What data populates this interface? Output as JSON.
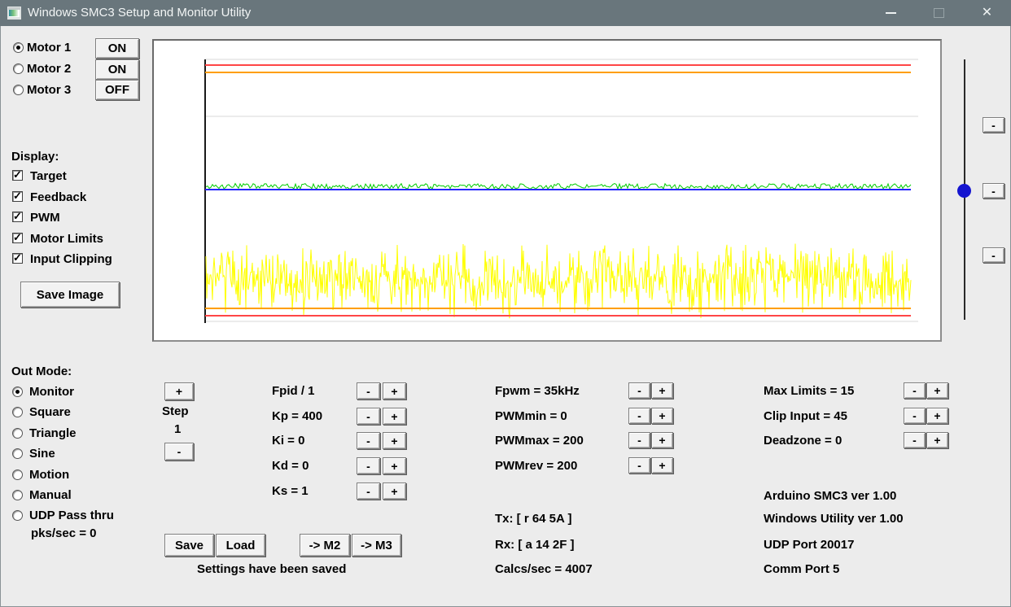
{
  "window": {
    "title": "Windows SMC3 Setup and Monitor Utility"
  },
  "titlebar": {
    "close_glyph": "✕"
  },
  "ui": {
    "minus": "-",
    "plus": "+",
    "check": "✓"
  },
  "motors": {
    "items": [
      {
        "label": "Motor 1",
        "selected": true,
        "power": "ON"
      },
      {
        "label": "Motor 2",
        "selected": false,
        "power": "ON"
      },
      {
        "label": "Motor 3",
        "selected": false,
        "power": "OFF"
      }
    ]
  },
  "display": {
    "label": "Display:",
    "items": [
      {
        "label": "Target",
        "checked": true
      },
      {
        "label": "Feedback",
        "checked": true
      },
      {
        "label": "PWM",
        "checked": true
      },
      {
        "label": "Motor Limits",
        "checked": true
      },
      {
        "label": "Input Clipping",
        "checked": true
      }
    ],
    "save_image": "Save Image"
  },
  "out_mode": {
    "label": "Out Mode:",
    "items": [
      {
        "label": "Monitor",
        "selected": true
      },
      {
        "label": "Square",
        "selected": false
      },
      {
        "label": "Triangle",
        "selected": false
      },
      {
        "label": "Sine",
        "selected": false
      },
      {
        "label": "Motion",
        "selected": false
      },
      {
        "label": "Manual",
        "selected": false
      },
      {
        "label": "UDP Pass thru",
        "selected": false
      }
    ],
    "pks": "pks/sec = 0"
  },
  "step": {
    "label": "Step",
    "value": "1"
  },
  "pid": {
    "rows": [
      {
        "label": "Fpid / 1"
      },
      {
        "label": "Kp = 400"
      },
      {
        "label": "Ki = 0"
      },
      {
        "label": "Kd = 0"
      },
      {
        "label": "Ks = 1"
      }
    ]
  },
  "pwm": {
    "rows": [
      {
        "label": "Fpwm = 35kHz"
      },
      {
        "label": "PWMmin = 0"
      },
      {
        "label": "PWMmax = 200"
      },
      {
        "label": "PWMrev = 200"
      }
    ]
  },
  "limits": {
    "rows": [
      {
        "label": "Max Limits = 15"
      },
      {
        "label": "Clip Input = 45"
      },
      {
        "label": "Deadzone = 0"
      }
    ]
  },
  "files": {
    "save": "Save",
    "load": "Load",
    "to_m2": "-> M2",
    "to_m3": "-> M3",
    "status": "Settings have been saved"
  },
  "comms": {
    "tx": "Tx: [ r 64 5A ]",
    "rx": "Rx: [ a 14 2F ]",
    "calcs": "Calcs/sec = 4007"
  },
  "info": {
    "lines": [
      {
        "text": "Arduino SMC3 ver 1.00"
      },
      {
        "text": "Windows Utility ver 1.00"
      },
      {
        "text": "UDP Port 20017"
      },
      {
        "text": "Comm Port 5"
      }
    ]
  },
  "chart_data": {
    "type": "line",
    "title": "",
    "xlabel": "",
    "ylabel": "",
    "note": "Scrolling oscilloscope view, no tick labels. Flat Target (blue) with noisy Feedback (green) at mid-scale, dense noisy PWM band (yellow) near bottom, Motor Limit lines (red) and Input Clipping lines (orange) near top and bottom edges.",
    "plot": {
      "x0": 63,
      "x1": 930,
      "grid_x1": 939,
      "y_top": 23,
      "y_bottom": 347
    },
    "grid_color": "#e6e6e6",
    "axis_color": "#1a1a1a",
    "gridlines_y": [
      23,
      93,
      345
    ],
    "series": [
      {
        "name": "Motor Limit upper",
        "color": "#ff4646",
        "style": "hline",
        "y": 30,
        "width": 2
      },
      {
        "name": "Input Clipping upper",
        "color": "#ff9e00",
        "style": "hline",
        "y": 39,
        "width": 2
      },
      {
        "name": "PWM",
        "color": "#ffff00",
        "style": "noise",
        "dist": "triangular",
        "seed": 1337,
        "step": 1,
        "min": 247,
        "max": 343
      },
      {
        "name": "Input Clipping lower",
        "color": "#ff9e00",
        "style": "hline",
        "y": 329,
        "width": 2
      },
      {
        "name": "Motor Limit lower",
        "color": "#ff4646",
        "style": "hline",
        "y": 338,
        "width": 2
      },
      {
        "name": "Feedback",
        "color": "#00cc00",
        "style": "noise",
        "dist": "uniform",
        "seed": 42,
        "step": 2,
        "base": 179,
        "amp": 3.4
      },
      {
        "name": "Target",
        "color": "#2424ff",
        "style": "hline",
        "y": 183,
        "width": 2
      }
    ]
  }
}
